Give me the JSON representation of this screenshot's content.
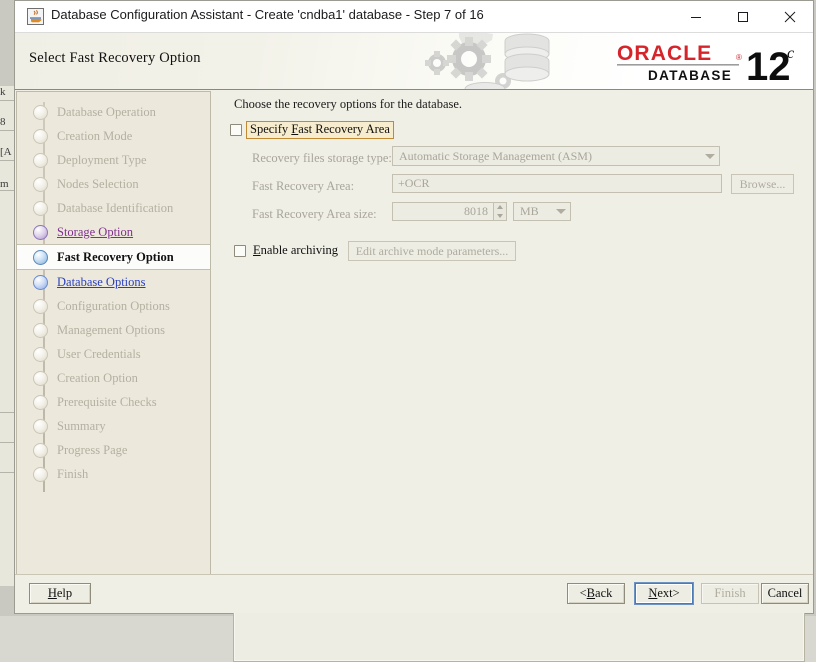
{
  "window": {
    "title": "Database Configuration Assistant - Create 'cndba1' database - Step 7 of 16",
    "icon": "java-cup-icon",
    "minimize_label": "–",
    "maximize_label": "☐",
    "close_label": "✕"
  },
  "banner": {
    "title": "Select Fast Recovery Option",
    "brand": "ORACLE",
    "brand_sub": "DATABASE",
    "version": "12",
    "version_sup": "c"
  },
  "sidebar": {
    "steps": [
      {
        "label": "Database Operation",
        "state": "todo"
      },
      {
        "label": "Creation Mode",
        "state": "todo"
      },
      {
        "label": "Deployment Type",
        "state": "todo"
      },
      {
        "label": "Nodes Selection",
        "state": "todo"
      },
      {
        "label": "Database Identification",
        "state": "todo"
      },
      {
        "label": "Storage Option",
        "state": "done"
      },
      {
        "label": "Fast Recovery Option",
        "state": "current"
      },
      {
        "label": "Database Options",
        "state": "next"
      },
      {
        "label": "Configuration Options",
        "state": "todo"
      },
      {
        "label": "Management Options",
        "state": "todo"
      },
      {
        "label": "User Credentials",
        "state": "todo"
      },
      {
        "label": "Creation Option",
        "state": "todo"
      },
      {
        "label": "Prerequisite Checks",
        "state": "todo"
      },
      {
        "label": "Summary",
        "state": "todo"
      },
      {
        "label": "Progress Page",
        "state": "todo"
      },
      {
        "label": "Finish",
        "state": "todo"
      }
    ]
  },
  "main": {
    "instruction": "Choose the recovery options for the database.",
    "specify_fra": {
      "label": "Specify Fast Recovery Area",
      "checked": false,
      "focused": true
    },
    "storage_type": {
      "label": "Recovery files storage type:",
      "value": "Automatic Storage Management (ASM)",
      "enabled": false
    },
    "fra_location": {
      "label": "Fast Recovery Area:",
      "value": "+OCR",
      "enabled": false
    },
    "browse": {
      "label": "Browse...",
      "enabled": false
    },
    "fra_size": {
      "label": "Fast Recovery Area size:",
      "value": "8018",
      "unit": "MB",
      "enabled": false
    },
    "enable_archiving": {
      "label": "Enable archiving",
      "checked": false
    },
    "edit_archive": {
      "label": "Edit archive mode parameters...",
      "enabled": false
    }
  },
  "footer": {
    "help": "Help",
    "back": "<Back",
    "next": "Next>",
    "finish": "Finish",
    "cancel": "Cancel"
  },
  "background_window": {
    "fragments": [
      "k",
      "8",
      "[A",
      "m"
    ]
  },
  "colors": {
    "brand_red": "#d5252b",
    "focus_orange": "#c08a32",
    "link_visited": "#7f2f8f",
    "link": "#2a3fbf",
    "panel_bg": "#f0efe6",
    "sidebar_bg": "#ece9dc"
  }
}
